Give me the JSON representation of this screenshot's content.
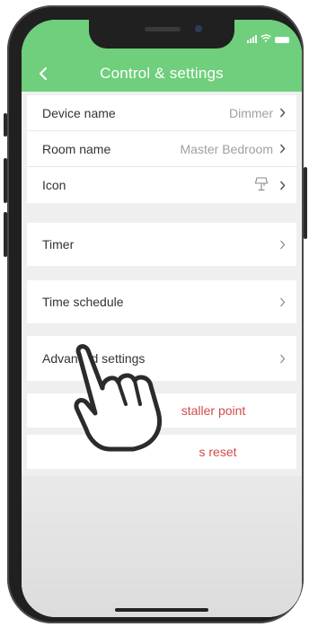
{
  "header": {
    "title": "Control & settings",
    "back_icon": "chevron-left-icon"
  },
  "status": {
    "icons": [
      "signal-icon",
      "wifi-icon",
      "battery-icon"
    ]
  },
  "device_section": {
    "items": [
      {
        "label": "Device name",
        "value": "Dimmer"
      },
      {
        "label": "Room name",
        "value": "Master Bedroom"
      },
      {
        "label": "Icon",
        "value_icon": "lamp-icon"
      }
    ]
  },
  "timer": {
    "label": "Timer"
  },
  "schedule": {
    "label": "Time schedule"
  },
  "advanced": {
    "label": "Advanced settings"
  },
  "installer": {
    "label_visible": "staller point"
  },
  "reset": {
    "label_visible": "s reset"
  },
  "colors": {
    "accent": "#6fcf7c",
    "danger": "#d14b4b",
    "text": "#333333",
    "muted": "#a0a0a0"
  }
}
